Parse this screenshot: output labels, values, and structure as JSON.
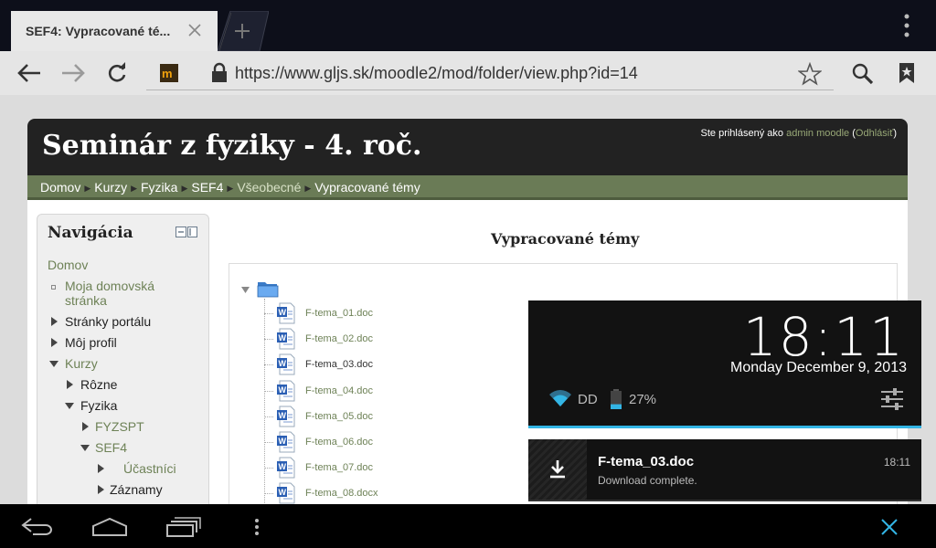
{
  "browser": {
    "tab_title": "SEF4: Vypracované té...",
    "url": "https://www.gljs.sk/moodle2/mod/folder/view.php?id=14"
  },
  "site": {
    "title": "Seminár z fyziky - 4. roč.",
    "login_prefix": "Ste prihlásený ako ",
    "login_user": "admin moodle",
    "login_open": " (",
    "login_logout": "Odhlásiť",
    "login_close": ")",
    "breadcrumbs": [
      "Domov",
      "Kurzy",
      "Fyzika",
      "SEF4",
      "Všeobecné",
      "Vypracované témy"
    ]
  },
  "navigation": {
    "title": "Navigácia",
    "items": [
      "Domov",
      "Moja domovská",
      "stránka",
      "Stránky portálu",
      "Môj profil",
      "Kurzy",
      "Rôzne",
      "Fyzika",
      "FYZSPT",
      "SEF4",
      "Účastníci",
      "Záznamy"
    ]
  },
  "content": {
    "title": "Vypracované témy",
    "files": [
      "F-tema_01.doc",
      "F-tema_02.doc",
      "F-tema_03.doc",
      "F-tema_04.doc",
      "F-tema_05.doc",
      "F-tema_06.doc",
      "F-tema_07.doc",
      "F-tema_08.docx"
    ]
  },
  "notifications": {
    "time": "18:11",
    "date": "Monday December 9, 2013",
    "network": "DD",
    "battery": "27%",
    "battery_level": 0.27,
    "download": {
      "title": "F-tema_03.doc",
      "subtitle": "Download complete.",
      "time": "18:11"
    }
  },
  "colors": {
    "accent": "#33b5e5",
    "moodle_green": "#6a7b56",
    "link_green": "#6e8257"
  }
}
